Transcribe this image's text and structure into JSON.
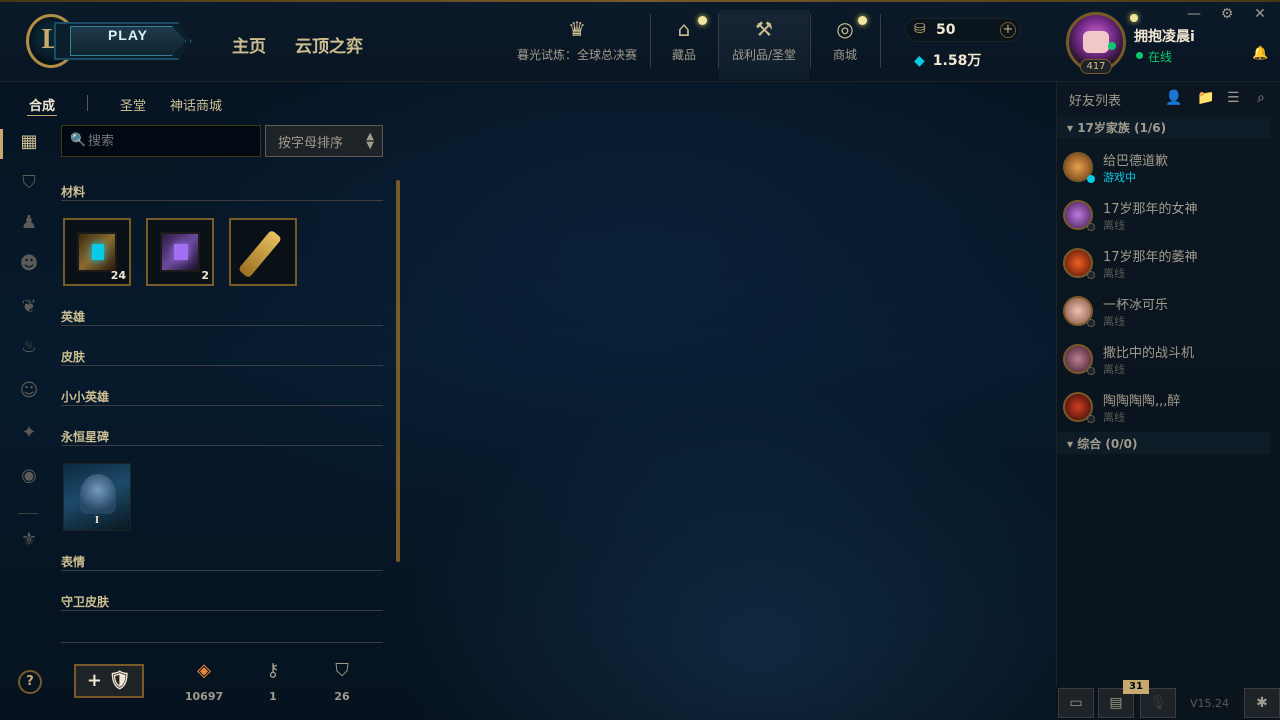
{
  "topbar": {
    "logo_letter": "L",
    "play_label": "PLAY",
    "nav": [
      "主页",
      "云顶之弈"
    ],
    "event_label": "暮光试炼：全球总决赛",
    "icons": [
      {
        "name": "collection-icon",
        "label": "藏品"
      },
      {
        "name": "loot-icon",
        "label": "战利品/圣堂"
      },
      {
        "name": "store-icon",
        "label": "商城"
      }
    ],
    "rp_value": "50",
    "plus_label": "+",
    "be_value": "1.58万"
  },
  "user": {
    "name": "拥抱凌晨i",
    "status": "在线",
    "level": "417"
  },
  "subtabs": [
    "合成",
    "圣堂",
    "神话商城"
  ],
  "search": {
    "placeholder": "搜索",
    "value": ""
  },
  "sort": {
    "label": "按字母排序"
  },
  "sections": {
    "materials": "材料",
    "champions": "英雄",
    "skins": "皮肤",
    "little_legends": "小小英雄",
    "eternals": "永恒星碑",
    "emotes": "表情",
    "ward_skins": "守卫皮肤"
  },
  "materials": [
    {
      "name": "hextech-chest",
      "count": "24"
    },
    {
      "name": "masterwork-chest",
      "count": "2"
    },
    {
      "name": "hextech-key",
      "count": ""
    }
  ],
  "eternals": [
    {
      "roman": "I"
    }
  ],
  "footer": {
    "help": "?",
    "add": "+ 🛡",
    "resources": [
      {
        "icon": "orange-essence-icon",
        "value": "10697"
      },
      {
        "icon": "key-fragment-icon",
        "value": "1"
      },
      {
        "icon": "token-icon",
        "value": "26"
      }
    ]
  },
  "friends": {
    "title": "好友列表",
    "groups": [
      {
        "label": "17岁家族 (1/6)"
      },
      {
        "label": "综合 (0/0)"
      }
    ],
    "items": [
      {
        "name": "给巴德道歉",
        "status": "游戏中",
        "ingame": true,
        "color": "#c8843a"
      },
      {
        "name": "17岁那年的女神",
        "status": "离线",
        "ingame": false,
        "color": "#8a4ab0"
      },
      {
        "name": "17岁那年的萎神",
        "status": "离线",
        "ingame": false,
        "color": "#b83a1a"
      },
      {
        "name": "一杯冰可乐",
        "status": "离线",
        "ingame": false,
        "color": "#d89a8a"
      },
      {
        "name": "撒比中的战斗机",
        "status": "离线",
        "ingame": false,
        "color": "#7a3a5a"
      },
      {
        "name": "陶陶陶陶,,,醉",
        "status": "离线",
        "ingame": false,
        "color": "#8a2a1a"
      }
    ]
  },
  "bottom": {
    "badge": "31",
    "version": "V15.24"
  }
}
